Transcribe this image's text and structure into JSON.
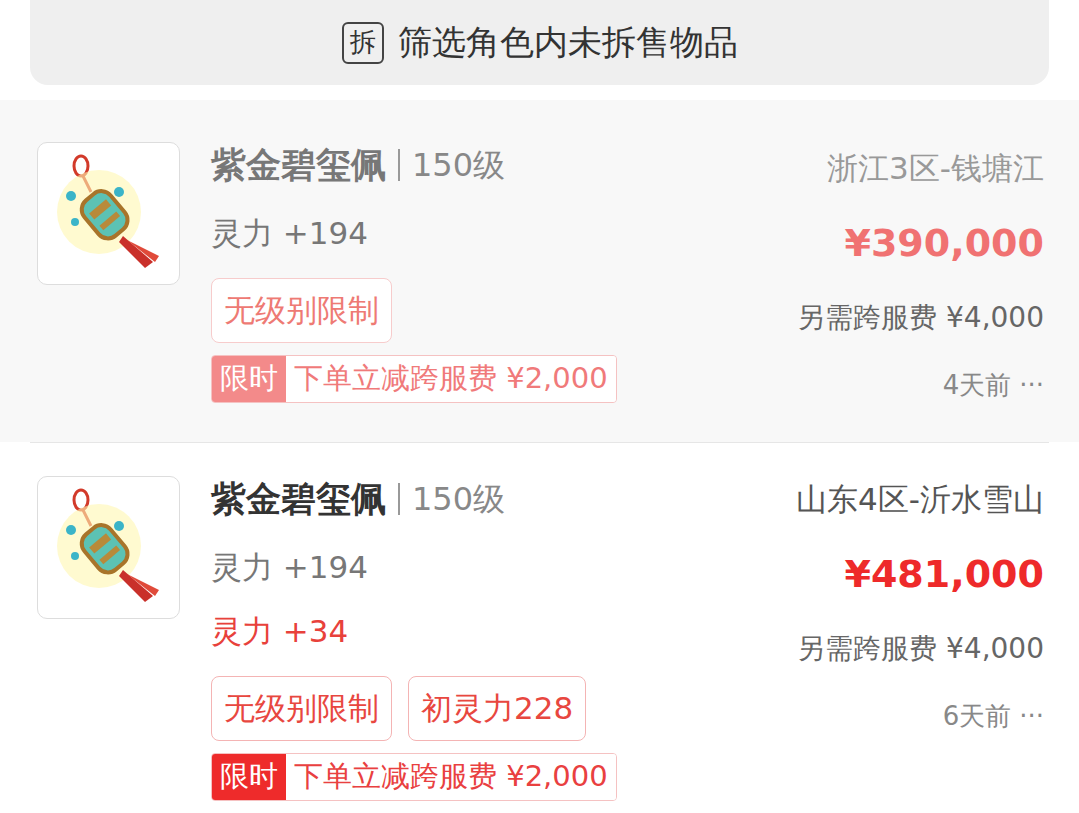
{
  "filter_bar": {
    "icon": "拆",
    "label": "筛选角色内未拆售物品"
  },
  "items": [
    {
      "faded": true,
      "name": "紫金碧玺佩",
      "grade": "150级",
      "attributes": [
        {
          "text": "灵力 +194",
          "kind": "base"
        }
      ],
      "tags": [
        "无级别限制"
      ],
      "promo": {
        "badge": "限时",
        "text": "下单立减跨服费 ¥2,000"
      },
      "server": "浙江3区-钱塘江",
      "price": "¥390,000",
      "fee": "另需跨服费 ¥4,000",
      "time": "4天前",
      "more": "···"
    },
    {
      "faded": false,
      "name": "紫金碧玺佩",
      "grade": "150级",
      "attributes": [
        {
          "text": "灵力 +194",
          "kind": "base"
        },
        {
          "text": "灵力 +34",
          "kind": "bonus"
        }
      ],
      "tags": [
        "无级别限制",
        "初灵力228"
      ],
      "promo": {
        "badge": "限时",
        "text": "下单立减跨服费 ¥2,000"
      },
      "server": "山东4区-沂水雪山",
      "price": "¥481,000",
      "fee": "另需跨服费 ¥4,000",
      "time": "6天前",
      "more": "···"
    }
  ]
}
